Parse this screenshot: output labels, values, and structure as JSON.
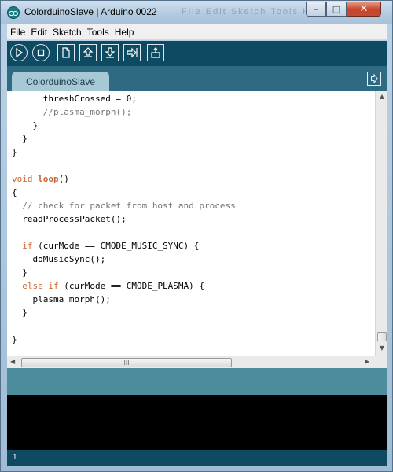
{
  "window": {
    "title": "ColorduinoSlave | Arduino 0022",
    "ghost_menu": "File  Edit  Sketch  Tools  Help",
    "controls": {
      "minimize": "–",
      "maximize": "□",
      "close": "✕"
    }
  },
  "menu": [
    "File",
    "Edit",
    "Sketch",
    "Tools",
    "Help"
  ],
  "toolbar": {
    "buttons": [
      "verify",
      "stop",
      "new",
      "open",
      "save",
      "upload",
      "serial-monitor"
    ]
  },
  "tab": {
    "label": "ColorduinoSlave"
  },
  "code_lines": [
    {
      "i": "      ",
      "t": "threshCrossed = 0;",
      "k": "plain"
    },
    {
      "i": "      ",
      "t": "//plasma_morph();",
      "k": "comment"
    },
    {
      "i": "    ",
      "t": "}",
      "k": "plain"
    },
    {
      "i": "  ",
      "t": "}",
      "k": "plain"
    },
    {
      "i": "",
      "t": "}",
      "k": "plain"
    },
    {
      "i": "",
      "t": "",
      "k": "plain"
    },
    {
      "i": "",
      "t": "void loop()",
      "k": "voidloop"
    },
    {
      "i": "",
      "t": "{",
      "k": "plain"
    },
    {
      "i": "  ",
      "t": "// check for packet from host and process",
      "k": "comment"
    },
    {
      "i": "  ",
      "t": "readProcessPacket();",
      "k": "plain"
    },
    {
      "i": "",
      "t": "",
      "k": "plain"
    },
    {
      "i": "  ",
      "t": "if (curMode == CMODE_MUSIC_SYNC) {",
      "k": "if"
    },
    {
      "i": "    ",
      "t": "doMusicSync();",
      "k": "plain"
    },
    {
      "i": "  ",
      "t": "}",
      "k": "plain"
    },
    {
      "i": "  ",
      "t": "else if (curMode == CMODE_PLASMA) {",
      "k": "elseif"
    },
    {
      "i": "    ",
      "t": "plasma_morph();",
      "k": "plain"
    },
    {
      "i": "  ",
      "t": "}",
      "k": "plain"
    },
    {
      "i": "",
      "t": "",
      "k": "plain"
    },
    {
      "i": "",
      "t": "}",
      "k": "plain"
    }
  ],
  "status": {
    "line_number": "1"
  },
  "scrollbar": {
    "grip": "III"
  },
  "colors": {
    "toolbar": "#0f4a63",
    "tabstrip": "#2e6a82",
    "status": "#4d8c9c",
    "keyword": "#cc6633"
  }
}
